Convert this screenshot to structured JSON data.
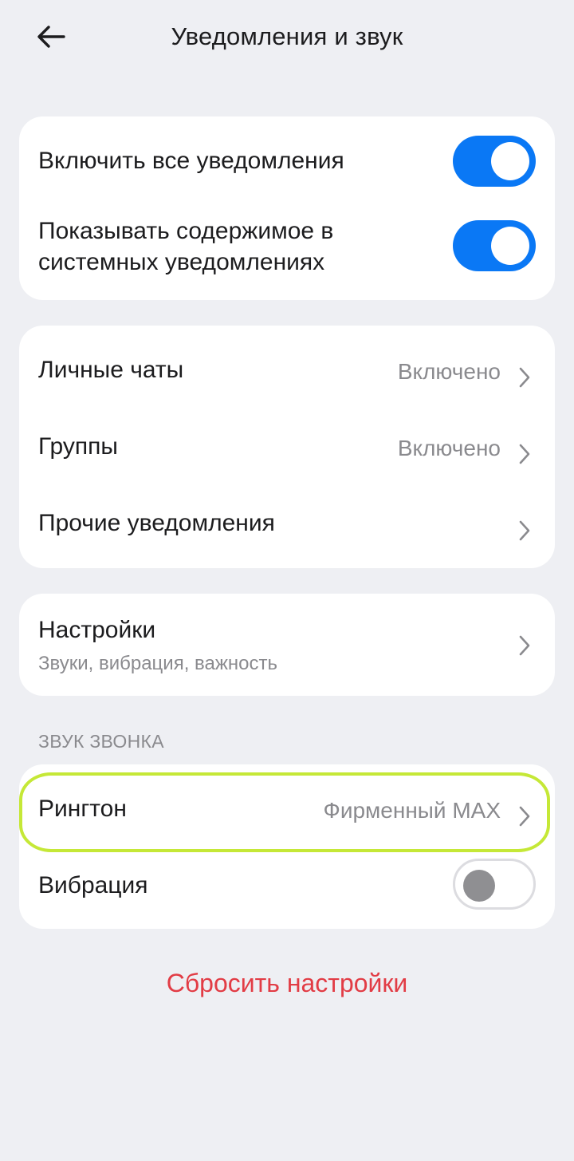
{
  "header": {
    "title": "Уведомления и звук",
    "back_icon": "arrow-left-icon"
  },
  "notifications": {
    "enable_all_label": "Включить все уведомления",
    "enable_all_on": true,
    "show_content_line1": "Показывать содержимое в",
    "show_content_line2": "системных уведомлениях",
    "show_content_on": true
  },
  "chats": {
    "items": [
      {
        "label": "Личные чаты",
        "value": "Включено"
      },
      {
        "label": "Группы",
        "value": "Включено"
      },
      {
        "label": "Прочие уведомления",
        "value": ""
      }
    ]
  },
  "settings": {
    "title": "Настройки",
    "subtitle": "Звуки, вибрация, важность"
  },
  "ringtone_section": {
    "header": "ЗВУК ЗВОНКА",
    "ringtone_label": "Рингтон",
    "ringtone_value": "Фирменный MAX",
    "vibration_label": "Вибрация",
    "vibration_on": false
  },
  "reset_label": "Сбросить настройки",
  "colors": {
    "accent": "#0a78f5",
    "danger": "#e23c45",
    "highlight": "#c5e837",
    "background": "#eeeff3"
  }
}
